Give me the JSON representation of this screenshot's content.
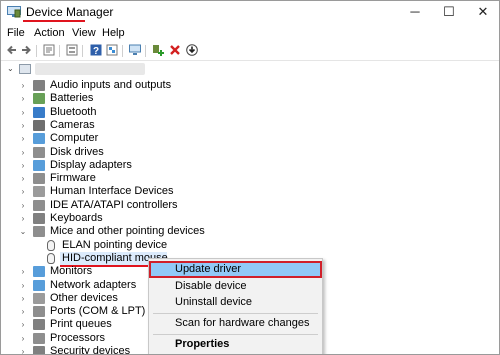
{
  "window": {
    "title": "Device Manager",
    "minimize_glyph": "─",
    "maximize_glyph": "☐",
    "close_glyph": "✕"
  },
  "menu": [
    "File",
    "Action",
    "View",
    "Help"
  ],
  "toolbar": {
    "icons": [
      "back-icon",
      "forward-icon",
      "properties-icon",
      "tree-view-icon",
      "help-icon",
      "device-view-icon",
      "scan-monitor-icon",
      "add-driver-icon",
      "uninstall-icon",
      "download-icon"
    ]
  },
  "tree": {
    "categories": [
      {
        "label": "Audio inputs and outputs",
        "icon": "speaker-icon",
        "color": "#6a6a6a"
      },
      {
        "label": "Batteries",
        "icon": "battery-icon",
        "color": "#4e8f3a"
      },
      {
        "label": "Bluetooth",
        "icon": "bluetooth-icon",
        "color": "#1565c0"
      },
      {
        "label": "Cameras",
        "icon": "camera-icon",
        "color": "#555555"
      },
      {
        "label": "Computer",
        "icon": "computer-icon",
        "color": "#3a8cd4"
      },
      {
        "label": "Disk drives",
        "icon": "disk-icon",
        "color": "#7a7a7a"
      },
      {
        "label": "Display adapters",
        "icon": "display-adapter-icon",
        "color": "#3a8cd4"
      },
      {
        "label": "Firmware",
        "icon": "firmware-icon",
        "color": "#7a7a7a"
      },
      {
        "label": "Human Interface Devices",
        "icon": "hid-icon",
        "color": "#8a8a8a"
      },
      {
        "label": "IDE ATA/ATAPI controllers",
        "icon": "ide-icon",
        "color": "#7a7a7a"
      },
      {
        "label": "Keyboards",
        "icon": "keyboard-icon",
        "color": "#6a6a6a"
      },
      {
        "label": "Mice and other pointing devices",
        "icon": "mouse-icon",
        "color": "#7a7a7a"
      }
    ],
    "mice_children": [
      {
        "label": "ELAN pointing device",
        "icon": "mouse-icon"
      },
      {
        "label": "HID-compliant mouse",
        "icon": "mouse-icon"
      }
    ],
    "after": [
      {
        "label": "Monitors",
        "icon": "monitor-icon",
        "color": "#3a8cd4"
      },
      {
        "label": "Network adapters",
        "icon": "network-icon",
        "color": "#3a8cd4"
      },
      {
        "label": "Other devices",
        "icon": "other-devices-icon",
        "color": "#8a8a8a"
      },
      {
        "label": "Ports (COM & LPT)",
        "icon": "port-icon",
        "color": "#7a7a7a"
      },
      {
        "label": "Print queues",
        "icon": "printer-icon",
        "color": "#6a6a6a"
      },
      {
        "label": "Processors",
        "icon": "processor-icon",
        "color": "#7a7a7a"
      },
      {
        "label": "Security devices",
        "icon": "security-icon",
        "color": "#6a6a6a"
      }
    ]
  },
  "context_menu": {
    "items": [
      "Update driver",
      "Disable device",
      "Uninstall device",
      "Scan for hardware changes",
      "Properties"
    ]
  },
  "colors": {
    "accent_red": "#e0141e",
    "selection": "#dcebfc",
    "menu_highlight": "#91c9f7"
  }
}
